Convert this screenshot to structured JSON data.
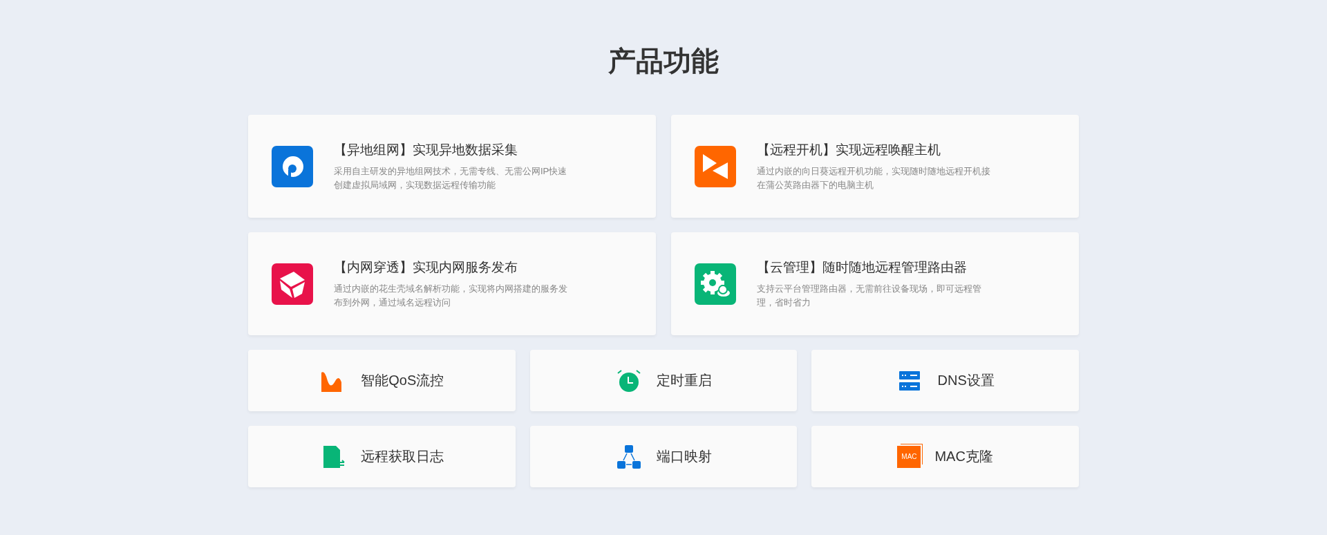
{
  "heading": "产品功能",
  "features": [
    {
      "kind": "network",
      "title": "【异地组网】实现异地数据采集",
      "description": "采用自主研发的异地组网技术，无需专线、无需公网IP快速创建虚拟局域网，实现数据远程传输功能",
      "color": "#0a74da"
    },
    {
      "kind": "power",
      "title": "【远程开机】实现远程唤醒主机",
      "description": "通过内嵌的向日葵远程开机功能，实现随时随地远程开机接在蒲公英路由器下的电脑主机",
      "color": "#ff6600"
    },
    {
      "kind": "penetrate",
      "title": "【内网穿透】实现内网服务发布",
      "description": "通过内嵌的花生壳域名解析功能，实现将内网搭建的服务发布到外网，通过域名远程访问",
      "color": "#e8124a"
    },
    {
      "kind": "cloud",
      "title": "【云管理】随时随地远程管理路由器",
      "description": "支持云平台管理路由器，无需前往设备现场，即可远程管理，省时省力",
      "color": "#08b577"
    }
  ],
  "tools": [
    {
      "kind": "qos",
      "label": "智能QoS流控"
    },
    {
      "kind": "timer",
      "label": "定时重启"
    },
    {
      "kind": "dns",
      "label": "DNS设置"
    },
    {
      "kind": "log",
      "label": "远程获取日志"
    },
    {
      "kind": "port",
      "label": "端口映射"
    },
    {
      "kind": "mac",
      "label": "MAC克隆",
      "icon_text": "MAC"
    }
  ]
}
